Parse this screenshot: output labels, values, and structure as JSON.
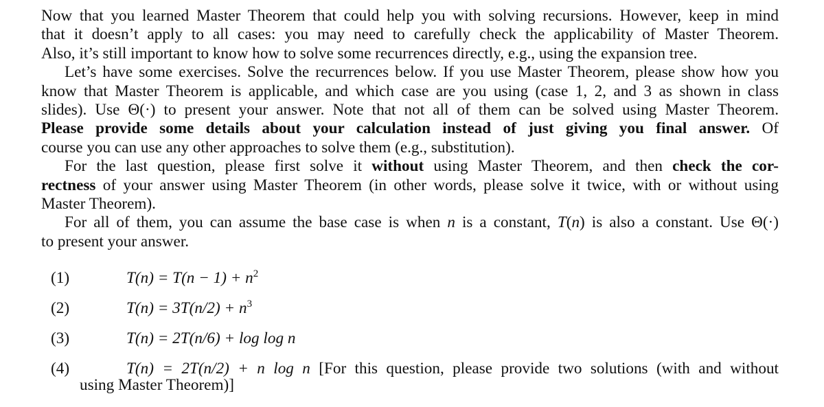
{
  "document": {
    "paragraph1": {
      "lines": [
        "Now that you learned Master Theorem that could help you with solving recursions. However, keep in mind",
        "that it doesn’t apply to all cases: you may need to carefully check the applicability of Master Theorem.",
        "Also, it’s still important to know how to solve some recurrences directly, e.g., using the expansion tree."
      ]
    },
    "paragraph2": {
      "line1": "Let’s have some exercises. Solve the recurrences below. If you use Master Theorem, please show how you",
      "line2": "know that Master Theorem is applicable, and which case are you using (case 1, 2, and 3 as shown in class",
      "line3": "slides). Use Θ(·) to present your answer. Note that not all of them can be solved using Master Theorem.",
      "line4_bold": "Please provide some details about your calculation instead of just giving you final answer.",
      "line4_tail": " Of",
      "line5": "course you can use any other approaches to solve them (e.g., substitution)."
    },
    "paragraph3": {
      "line1_a": "For the last question, please first solve it ",
      "line1_bold1": "without",
      "line1_b": " using Master Theorem, and then ",
      "line1_bold2": "check the cor-",
      "line2_bold": "rectness",
      "line2_rest": " of your answer using Master Theorem (in other words, please solve it twice, with or without using",
      "line3": "Master Theorem)."
    },
    "paragraph4": {
      "line1_a": "For all of them, you can assume the base case is when ",
      "line1_var": "n",
      "line1_b": " is a constant, ",
      "line1_func": "T",
      "line1_c": "(",
      "line1_d": ")",
      "line1_e": " is also a constant. Use Θ(·)",
      "line2": "to present your answer."
    }
  },
  "equations": [
    {
      "number": "(1)",
      "lhs": "T(n)",
      "rhs": "= T(n − 1) + n",
      "sup": "2"
    },
    {
      "number": "(2)",
      "lhs": "T(n)",
      "rhs": "= 3T(n/2) + n",
      "sup": "3"
    },
    {
      "number": "(3)",
      "lhs": "T(n)",
      "rhs": "= 2T(n/6) + log log n",
      "sup": ""
    },
    {
      "number": "(4)",
      "lhs": "T(n)",
      "rhs": "= 2T(n/2) + n log n",
      "note": "[For this question, please provide two solutions (with and without",
      "note_cont": "using Master Theorem)]"
    }
  ]
}
